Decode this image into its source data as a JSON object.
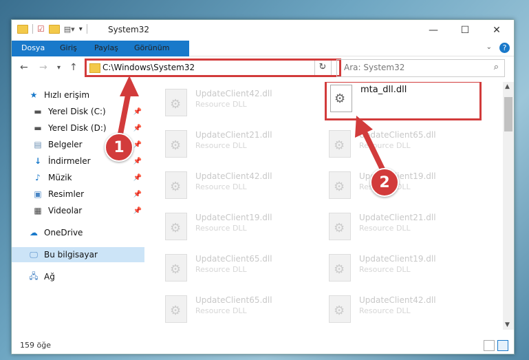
{
  "window": {
    "title": "System32",
    "min": "—",
    "max": "☐",
    "close": "✕"
  },
  "ribbon": {
    "tabs": [
      "Dosya",
      "Giriş",
      "Paylaş",
      "Görünüm"
    ]
  },
  "nav": {
    "address": "C:\\Windows\\System32",
    "search_placeholder": "Ara: System32"
  },
  "sidebar": {
    "items": [
      {
        "label": "Hızlı erişim",
        "icon": "star-icon"
      },
      {
        "label": "Yerel Disk (C:)",
        "icon": "drive-icon"
      },
      {
        "label": "Yerel Disk (D:)",
        "icon": "drive-icon"
      },
      {
        "label": "Belgeler",
        "icon": "documents-icon"
      },
      {
        "label": "İndirmeler",
        "icon": "download-icon"
      },
      {
        "label": "Müzik",
        "icon": "music-icon"
      },
      {
        "label": "Resimler",
        "icon": "pictures-icon"
      },
      {
        "label": "Videolar",
        "icon": "videos-icon"
      },
      {
        "label": "OneDrive",
        "icon": "cloud-icon"
      },
      {
        "label": "Bu bilgisayar",
        "icon": "computer-icon"
      },
      {
        "label": "Ağ",
        "icon": "network-icon"
      }
    ]
  },
  "files": {
    "left": [
      {
        "name": "UpdateClient42.dll",
        "type": "Resource DLL"
      },
      {
        "name": "UpdateClient21.dll",
        "type": "Resource DLL"
      },
      {
        "name": "UpdateClient42.dll",
        "type": "Resource DLL"
      },
      {
        "name": "UpdateClient19.dll",
        "type": "Resource DLL"
      },
      {
        "name": "UpdateClient65.dll",
        "type": "Resource DLL"
      },
      {
        "name": "UpdateClient65.dll",
        "type": "Resource DLL"
      }
    ],
    "right": [
      {
        "name": "mta_dll.dll",
        "type": ""
      },
      {
        "name": "UpdateClient65.dll",
        "type": "Resource DLL"
      },
      {
        "name": "UpdateClient19.dll",
        "type": "Resource DLL"
      },
      {
        "name": "UpdateClient21.dll",
        "type": "Resource DLL"
      },
      {
        "name": "UpdateClient19.dll",
        "type": "Resource DLL"
      },
      {
        "name": "UpdateClient42.dll",
        "type": "Resource DLL"
      }
    ]
  },
  "status": {
    "count": "159 öğe"
  },
  "annotations": {
    "step1": "1",
    "step2": "2"
  },
  "colors": {
    "accent": "#1979ca",
    "highlight": "#d23b3b"
  }
}
